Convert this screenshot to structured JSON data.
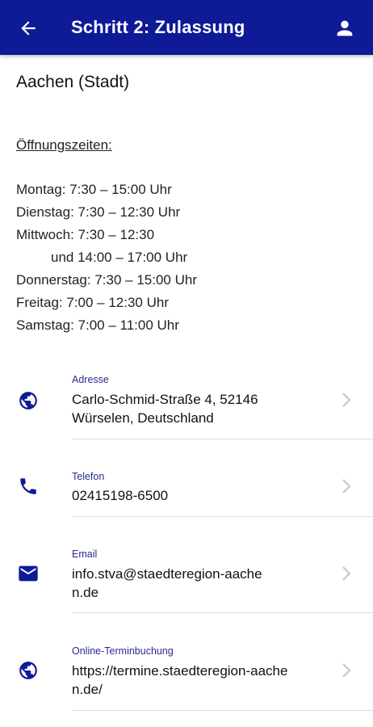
{
  "header": {
    "title": "Schritt 2: Zulassung",
    "icons": {
      "back": "arrow-back-icon",
      "profile": "person-icon"
    }
  },
  "office": {
    "name": "Aachen (Stadt)",
    "hours_heading": "Öffnungszeiten:",
    "hours": [
      "Montag: 7:30 – 15:00 Uhr",
      "Dienstag: 7:30 – 12:30 Uhr",
      "Mittwoch: 7:30 – 12:30",
      "und 14:00 – 17:00 Uhr",
      "Donnerstag: 7:30 – 15:00 Uhr",
      "Freitag: 7:00 – 12:30 Uhr",
      "Samstag: 7:00 – 11:00 Uhr"
    ]
  },
  "contacts": [
    {
      "label": "Adresse",
      "value": "Carlo-Schmid-Straße 4, 52146 Würselen, Deutschland",
      "icon": "globe-icon"
    },
    {
      "label": "Telefon",
      "value": "02415198-6500",
      "icon": "phone-icon"
    },
    {
      "label": "Email",
      "value": "info.stva@staedteregion-aachen.de",
      "icon": "mail-icon"
    },
    {
      "label": "Online-Terminbuchung",
      "value": "https://termine.staedteregion-aachen.de/",
      "icon": "globe-icon"
    }
  ],
  "colors": {
    "primary": "#0f1a96",
    "label": "#2a2a8f",
    "divider": "#dcdcdc",
    "chevron": "#c4c4c4"
  }
}
